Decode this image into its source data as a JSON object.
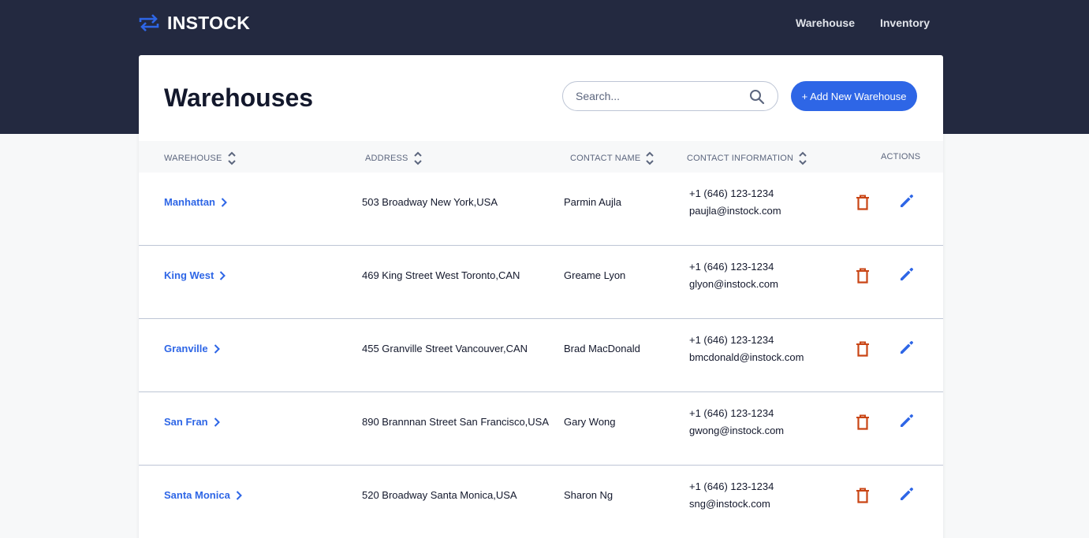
{
  "header": {
    "brand": "INSTOCK",
    "nav": [
      {
        "label": "Warehouse"
      },
      {
        "label": "Inventory"
      }
    ]
  },
  "page": {
    "title": "Warehouses",
    "search_placeholder": "Search...",
    "add_button": "+ Add New Warehouse"
  },
  "table": {
    "columns": [
      "WAREHOUSE",
      "ADDRESS",
      "CONTACT NAME",
      "CONTACT INFORMATION",
      "ACTIONS"
    ],
    "rows": [
      {
        "warehouse": "Manhattan",
        "address": "503 Broadway New York,USA",
        "contact_name": "Parmin Aujla",
        "phone": "+1 (646) 123-1234",
        "email": "paujla@instock.com"
      },
      {
        "warehouse": "King West",
        "address": "469 King Street West Toronto,CAN",
        "contact_name": "Greame Lyon",
        "phone": "+1 (646) 123-1234",
        "email": "glyon@instock.com"
      },
      {
        "warehouse": "Granville",
        "address": "455 Granville Street Vancouver,CAN",
        "contact_name": "Brad MacDonald",
        "phone": "+1 (646) 123-1234",
        "email": "bmcdonald@instock.com"
      },
      {
        "warehouse": "San Fran",
        "address": "890 Brannnan Street San Francisco,USA",
        "contact_name": "Gary Wong",
        "phone": "+1 (646) 123-1234",
        "email": "gwong@instock.com"
      },
      {
        "warehouse": "Santa Monica",
        "address": "520 Broadway Santa Monica,USA",
        "contact_name": "Sharon Ng",
        "phone": "+1 (646) 123-1234",
        "email": "sng@instock.com"
      }
    ]
  },
  "icons": {
    "logo": "swap-arrows-icon",
    "search": "search-icon",
    "sort": "sort-icon",
    "chevron": "chevron-right-icon",
    "delete": "delete-icon",
    "edit": "edit-icon"
  },
  "colors": {
    "header_bg": "#232940",
    "accent": "#2E66E6",
    "delete": "#C94515",
    "divider": "#BDC5D5",
    "text": "#13182C",
    "muted": "#5C667E"
  }
}
